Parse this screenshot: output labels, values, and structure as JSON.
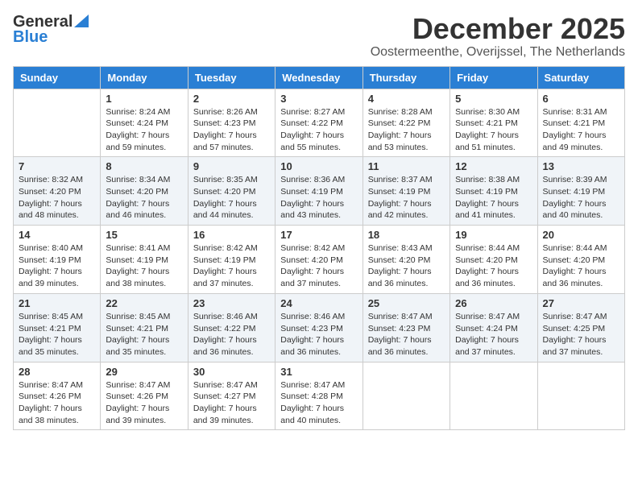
{
  "header": {
    "logo_general": "General",
    "logo_blue": "Blue",
    "month_title": "December 2025",
    "subtitle": "Oostermeenthe, Overijssel, The Netherlands"
  },
  "days_of_week": [
    "Sunday",
    "Monday",
    "Tuesday",
    "Wednesday",
    "Thursday",
    "Friday",
    "Saturday"
  ],
  "weeks": [
    [
      {
        "day": "",
        "info": ""
      },
      {
        "day": "1",
        "info": "Sunrise: 8:24 AM\nSunset: 4:24 PM\nDaylight: 7 hours\nand 59 minutes."
      },
      {
        "day": "2",
        "info": "Sunrise: 8:26 AM\nSunset: 4:23 PM\nDaylight: 7 hours\nand 57 minutes."
      },
      {
        "day": "3",
        "info": "Sunrise: 8:27 AM\nSunset: 4:22 PM\nDaylight: 7 hours\nand 55 minutes."
      },
      {
        "day": "4",
        "info": "Sunrise: 8:28 AM\nSunset: 4:22 PM\nDaylight: 7 hours\nand 53 minutes."
      },
      {
        "day": "5",
        "info": "Sunrise: 8:30 AM\nSunset: 4:21 PM\nDaylight: 7 hours\nand 51 minutes."
      },
      {
        "day": "6",
        "info": "Sunrise: 8:31 AM\nSunset: 4:21 PM\nDaylight: 7 hours\nand 49 minutes."
      }
    ],
    [
      {
        "day": "7",
        "info": "Sunrise: 8:32 AM\nSunset: 4:20 PM\nDaylight: 7 hours\nand 48 minutes."
      },
      {
        "day": "8",
        "info": "Sunrise: 8:34 AM\nSunset: 4:20 PM\nDaylight: 7 hours\nand 46 minutes."
      },
      {
        "day": "9",
        "info": "Sunrise: 8:35 AM\nSunset: 4:20 PM\nDaylight: 7 hours\nand 44 minutes."
      },
      {
        "day": "10",
        "info": "Sunrise: 8:36 AM\nSunset: 4:19 PM\nDaylight: 7 hours\nand 43 minutes."
      },
      {
        "day": "11",
        "info": "Sunrise: 8:37 AM\nSunset: 4:19 PM\nDaylight: 7 hours\nand 42 minutes."
      },
      {
        "day": "12",
        "info": "Sunrise: 8:38 AM\nSunset: 4:19 PM\nDaylight: 7 hours\nand 41 minutes."
      },
      {
        "day": "13",
        "info": "Sunrise: 8:39 AM\nSunset: 4:19 PM\nDaylight: 7 hours\nand 40 minutes."
      }
    ],
    [
      {
        "day": "14",
        "info": "Sunrise: 8:40 AM\nSunset: 4:19 PM\nDaylight: 7 hours\nand 39 minutes."
      },
      {
        "day": "15",
        "info": "Sunrise: 8:41 AM\nSunset: 4:19 PM\nDaylight: 7 hours\nand 38 minutes."
      },
      {
        "day": "16",
        "info": "Sunrise: 8:42 AM\nSunset: 4:19 PM\nDaylight: 7 hours\nand 37 minutes."
      },
      {
        "day": "17",
        "info": "Sunrise: 8:42 AM\nSunset: 4:20 PM\nDaylight: 7 hours\nand 37 minutes."
      },
      {
        "day": "18",
        "info": "Sunrise: 8:43 AM\nSunset: 4:20 PM\nDaylight: 7 hours\nand 36 minutes."
      },
      {
        "day": "19",
        "info": "Sunrise: 8:44 AM\nSunset: 4:20 PM\nDaylight: 7 hours\nand 36 minutes."
      },
      {
        "day": "20",
        "info": "Sunrise: 8:44 AM\nSunset: 4:20 PM\nDaylight: 7 hours\nand 36 minutes."
      }
    ],
    [
      {
        "day": "21",
        "info": "Sunrise: 8:45 AM\nSunset: 4:21 PM\nDaylight: 7 hours\nand 35 minutes."
      },
      {
        "day": "22",
        "info": "Sunrise: 8:45 AM\nSunset: 4:21 PM\nDaylight: 7 hours\nand 35 minutes."
      },
      {
        "day": "23",
        "info": "Sunrise: 8:46 AM\nSunset: 4:22 PM\nDaylight: 7 hours\nand 36 minutes."
      },
      {
        "day": "24",
        "info": "Sunrise: 8:46 AM\nSunset: 4:23 PM\nDaylight: 7 hours\nand 36 minutes."
      },
      {
        "day": "25",
        "info": "Sunrise: 8:47 AM\nSunset: 4:23 PM\nDaylight: 7 hours\nand 36 minutes."
      },
      {
        "day": "26",
        "info": "Sunrise: 8:47 AM\nSunset: 4:24 PM\nDaylight: 7 hours\nand 37 minutes."
      },
      {
        "day": "27",
        "info": "Sunrise: 8:47 AM\nSunset: 4:25 PM\nDaylight: 7 hours\nand 37 minutes."
      }
    ],
    [
      {
        "day": "28",
        "info": "Sunrise: 8:47 AM\nSunset: 4:26 PM\nDaylight: 7 hours\nand 38 minutes."
      },
      {
        "day": "29",
        "info": "Sunrise: 8:47 AM\nSunset: 4:26 PM\nDaylight: 7 hours\nand 39 minutes."
      },
      {
        "day": "30",
        "info": "Sunrise: 8:47 AM\nSunset: 4:27 PM\nDaylight: 7 hours\nand 39 minutes."
      },
      {
        "day": "31",
        "info": "Sunrise: 8:47 AM\nSunset: 4:28 PM\nDaylight: 7 hours\nand 40 minutes."
      },
      {
        "day": "",
        "info": ""
      },
      {
        "day": "",
        "info": ""
      },
      {
        "day": "",
        "info": ""
      }
    ]
  ]
}
